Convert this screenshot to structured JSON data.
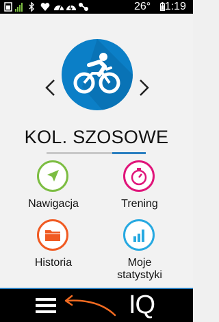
{
  "status": {
    "temperature": "26°",
    "time": "11:19",
    "icons": [
      "gps-locked-icon",
      "signal-bars-icon",
      "bluetooth-icon",
      "heart-rate-icon",
      "speed-sensor-icon",
      "power-icon",
      "cadence-icon",
      "battery-icon"
    ]
  },
  "activity": {
    "name": "KOL. SZOSOWE",
    "icon": "road-bike-icon",
    "circle_color": "#0b7fc7"
  },
  "tiles": [
    {
      "id": "navigation",
      "label": "Nawigacja",
      "icon": "navigation-arrow-icon",
      "color": "#7cbd42"
    },
    {
      "id": "training",
      "label": "Trening",
      "icon": "stopwatch-icon",
      "color": "#e0157a"
    },
    {
      "id": "history",
      "label": "Historia",
      "icon": "folder-icon",
      "color": "#f05a22"
    },
    {
      "id": "stats",
      "label": "Moje statystyki",
      "label_line1": "Moje",
      "label_line2": "statystyki",
      "icon": "bar-chart-icon",
      "color": "#27a9e1"
    }
  ],
  "bottom": {
    "menu_icon": "hamburger-menu-icon",
    "iq_label": "IQ",
    "annotation_color": "#f26b21"
  }
}
